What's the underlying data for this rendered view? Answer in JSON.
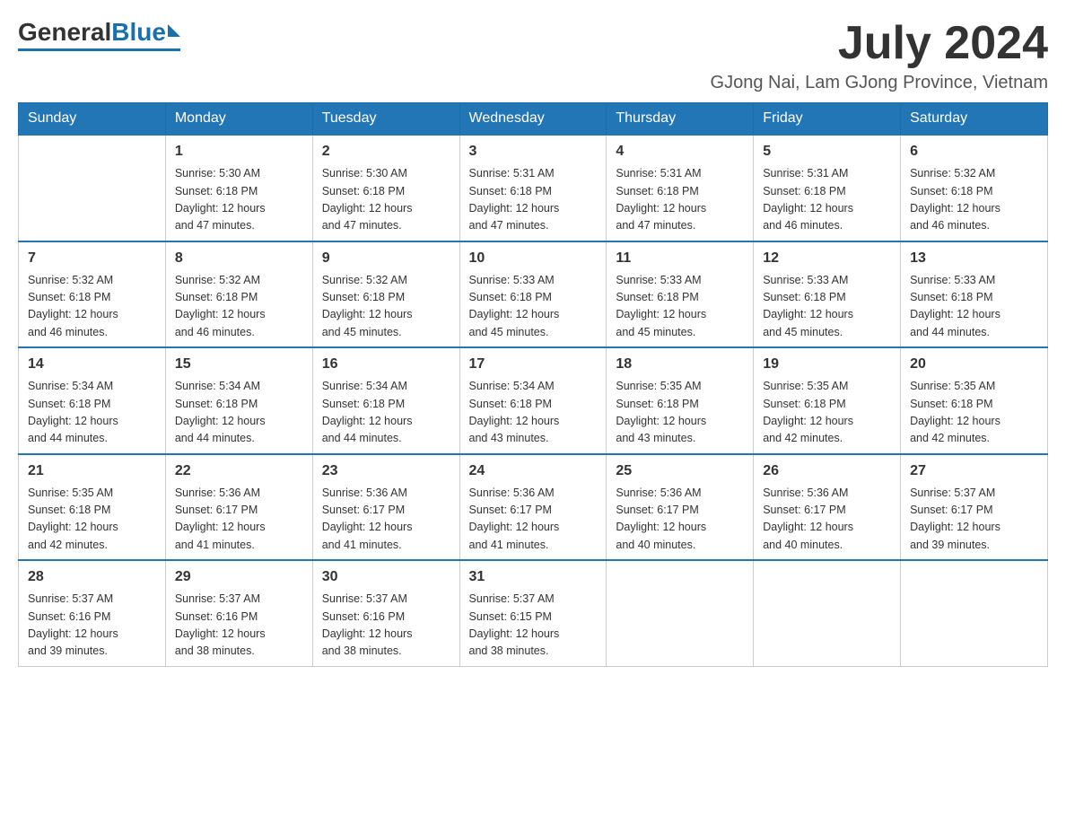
{
  "logo": {
    "general": "General",
    "blue": "Blue"
  },
  "header": {
    "month_year": "July 2024",
    "location": "GJong Nai, Lam GJong Province, Vietnam"
  },
  "weekdays": [
    "Sunday",
    "Monday",
    "Tuesday",
    "Wednesday",
    "Thursday",
    "Friday",
    "Saturday"
  ],
  "weeks": [
    [
      {
        "day": "",
        "info": ""
      },
      {
        "day": "1",
        "info": "Sunrise: 5:30 AM\nSunset: 6:18 PM\nDaylight: 12 hours\nand 47 minutes."
      },
      {
        "day": "2",
        "info": "Sunrise: 5:30 AM\nSunset: 6:18 PM\nDaylight: 12 hours\nand 47 minutes."
      },
      {
        "day": "3",
        "info": "Sunrise: 5:31 AM\nSunset: 6:18 PM\nDaylight: 12 hours\nand 47 minutes."
      },
      {
        "day": "4",
        "info": "Sunrise: 5:31 AM\nSunset: 6:18 PM\nDaylight: 12 hours\nand 47 minutes."
      },
      {
        "day": "5",
        "info": "Sunrise: 5:31 AM\nSunset: 6:18 PM\nDaylight: 12 hours\nand 46 minutes."
      },
      {
        "day": "6",
        "info": "Sunrise: 5:32 AM\nSunset: 6:18 PM\nDaylight: 12 hours\nand 46 minutes."
      }
    ],
    [
      {
        "day": "7",
        "info": "Sunrise: 5:32 AM\nSunset: 6:18 PM\nDaylight: 12 hours\nand 46 minutes."
      },
      {
        "day": "8",
        "info": "Sunrise: 5:32 AM\nSunset: 6:18 PM\nDaylight: 12 hours\nand 46 minutes."
      },
      {
        "day": "9",
        "info": "Sunrise: 5:32 AM\nSunset: 6:18 PM\nDaylight: 12 hours\nand 45 minutes."
      },
      {
        "day": "10",
        "info": "Sunrise: 5:33 AM\nSunset: 6:18 PM\nDaylight: 12 hours\nand 45 minutes."
      },
      {
        "day": "11",
        "info": "Sunrise: 5:33 AM\nSunset: 6:18 PM\nDaylight: 12 hours\nand 45 minutes."
      },
      {
        "day": "12",
        "info": "Sunrise: 5:33 AM\nSunset: 6:18 PM\nDaylight: 12 hours\nand 45 minutes."
      },
      {
        "day": "13",
        "info": "Sunrise: 5:33 AM\nSunset: 6:18 PM\nDaylight: 12 hours\nand 44 minutes."
      }
    ],
    [
      {
        "day": "14",
        "info": "Sunrise: 5:34 AM\nSunset: 6:18 PM\nDaylight: 12 hours\nand 44 minutes."
      },
      {
        "day": "15",
        "info": "Sunrise: 5:34 AM\nSunset: 6:18 PM\nDaylight: 12 hours\nand 44 minutes."
      },
      {
        "day": "16",
        "info": "Sunrise: 5:34 AM\nSunset: 6:18 PM\nDaylight: 12 hours\nand 44 minutes."
      },
      {
        "day": "17",
        "info": "Sunrise: 5:34 AM\nSunset: 6:18 PM\nDaylight: 12 hours\nand 43 minutes."
      },
      {
        "day": "18",
        "info": "Sunrise: 5:35 AM\nSunset: 6:18 PM\nDaylight: 12 hours\nand 43 minutes."
      },
      {
        "day": "19",
        "info": "Sunrise: 5:35 AM\nSunset: 6:18 PM\nDaylight: 12 hours\nand 42 minutes."
      },
      {
        "day": "20",
        "info": "Sunrise: 5:35 AM\nSunset: 6:18 PM\nDaylight: 12 hours\nand 42 minutes."
      }
    ],
    [
      {
        "day": "21",
        "info": "Sunrise: 5:35 AM\nSunset: 6:18 PM\nDaylight: 12 hours\nand 42 minutes."
      },
      {
        "day": "22",
        "info": "Sunrise: 5:36 AM\nSunset: 6:17 PM\nDaylight: 12 hours\nand 41 minutes."
      },
      {
        "day": "23",
        "info": "Sunrise: 5:36 AM\nSunset: 6:17 PM\nDaylight: 12 hours\nand 41 minutes."
      },
      {
        "day": "24",
        "info": "Sunrise: 5:36 AM\nSunset: 6:17 PM\nDaylight: 12 hours\nand 41 minutes."
      },
      {
        "day": "25",
        "info": "Sunrise: 5:36 AM\nSunset: 6:17 PM\nDaylight: 12 hours\nand 40 minutes."
      },
      {
        "day": "26",
        "info": "Sunrise: 5:36 AM\nSunset: 6:17 PM\nDaylight: 12 hours\nand 40 minutes."
      },
      {
        "day": "27",
        "info": "Sunrise: 5:37 AM\nSunset: 6:17 PM\nDaylight: 12 hours\nand 39 minutes."
      }
    ],
    [
      {
        "day": "28",
        "info": "Sunrise: 5:37 AM\nSunset: 6:16 PM\nDaylight: 12 hours\nand 39 minutes."
      },
      {
        "day": "29",
        "info": "Sunrise: 5:37 AM\nSunset: 6:16 PM\nDaylight: 12 hours\nand 38 minutes."
      },
      {
        "day": "30",
        "info": "Sunrise: 5:37 AM\nSunset: 6:16 PM\nDaylight: 12 hours\nand 38 minutes."
      },
      {
        "day": "31",
        "info": "Sunrise: 5:37 AM\nSunset: 6:15 PM\nDaylight: 12 hours\nand 38 minutes."
      },
      {
        "day": "",
        "info": ""
      },
      {
        "day": "",
        "info": ""
      },
      {
        "day": "",
        "info": ""
      }
    ]
  ],
  "accent_color": "#2376b5"
}
